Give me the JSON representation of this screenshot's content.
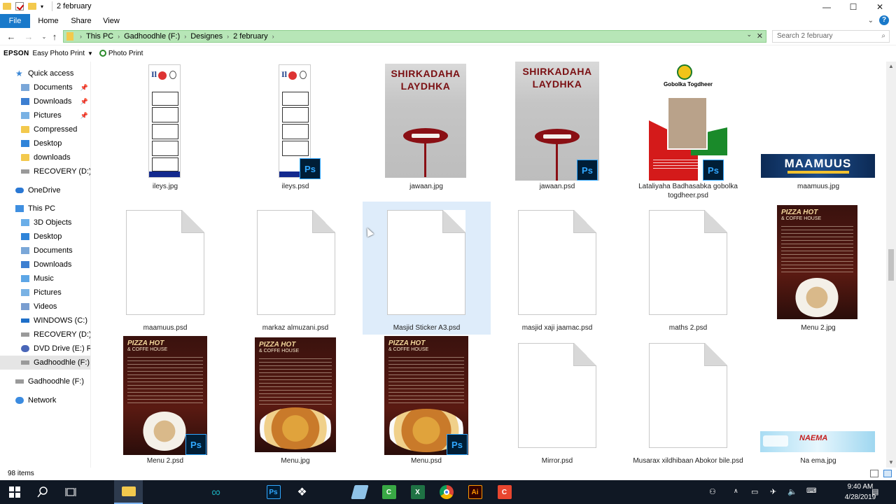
{
  "window": {
    "title": "2 february",
    "controls": {
      "minimize": "—",
      "maximize": "☐",
      "close": "✕"
    }
  },
  "ribbon": {
    "tabs": [
      {
        "label": "File"
      },
      {
        "label": "Home"
      },
      {
        "label": "Share"
      },
      {
        "label": "View"
      }
    ],
    "help": "?"
  },
  "address": {
    "crumbs": [
      "This PC",
      "Gadhoodhle (F:)",
      "Designes",
      "2 february"
    ]
  },
  "search": {
    "placeholder": "Search 2 february"
  },
  "epson": {
    "brand": "EPSON",
    "easy_photo_print": "Easy Photo Print",
    "photo_print": "Photo Print"
  },
  "sidebar": {
    "items": [
      {
        "label": "Quick access"
      },
      {
        "label": "Documents"
      },
      {
        "label": "Downloads"
      },
      {
        "label": "Pictures"
      },
      {
        "label": "Compressed"
      },
      {
        "label": "Desktop"
      },
      {
        "label": "downloads"
      },
      {
        "label": "RECOVERY (D:)"
      },
      {
        "label": "OneDrive"
      },
      {
        "label": "This PC"
      },
      {
        "label": "3D Objects"
      },
      {
        "label": "Desktop"
      },
      {
        "label": "Documents"
      },
      {
        "label": "Downloads"
      },
      {
        "label": "Music"
      },
      {
        "label": "Pictures"
      },
      {
        "label": "Videos"
      },
      {
        "label": "WINDOWS (C:)"
      },
      {
        "label": "RECOVERY (D:)"
      },
      {
        "label": "DVD Drive (E:) Resid"
      },
      {
        "label": "Gadhoodhle (F:)"
      },
      {
        "label": "Gadhoodhle (F:)"
      },
      {
        "label": "Network"
      }
    ]
  },
  "files": [
    {
      "name": "ileys.jpg"
    },
    {
      "name": "ileys.psd"
    },
    {
      "name": "jawaan.jpg"
    },
    {
      "name": "jawaan.psd"
    },
    {
      "name": "Lataliyaha Badhasabka gobolka togdheer.psd"
    },
    {
      "name": "maamuus.jpg"
    },
    {
      "name": "maamuus.psd"
    },
    {
      "name": "markaz almuzani.psd"
    },
    {
      "name": "Masjid Sticker A3.psd"
    },
    {
      "name": "masjid xaji jaamac.psd"
    },
    {
      "name": "maths 2.psd"
    },
    {
      "name": "Menu 2.jpg"
    },
    {
      "name": "Menu 2.psd"
    },
    {
      "name": "Menu.jpg"
    },
    {
      "name": "Menu.psd"
    },
    {
      "name": "Mirror.psd"
    },
    {
      "name": "Musarax xildhibaan Abokor bile.psd"
    },
    {
      "name": "Na ema.jpg"
    }
  ],
  "thumb_text": {
    "ileys_logo": "Il",
    "shirkadaha": "SHIRKADAHA",
    "laydhka": "LAYDHKA",
    "gobolka": "Gobolka Togdheer",
    "maamuus_banner": "MAAMUUS",
    "pizza_hot": "PIZZA HOT",
    "coffee_house": "& COFFE HOUSE",
    "naema": "NAEMA",
    "ps": "Ps"
  },
  "status": {
    "items": "98 items"
  },
  "clock": {
    "time": "9:40 AM",
    "date": "4/28/2019"
  },
  "colors": {
    "accent": "#1979ca",
    "address_highlight": "#b7e6b7",
    "selection": "#deecfa",
    "taskbar": "#101824"
  }
}
